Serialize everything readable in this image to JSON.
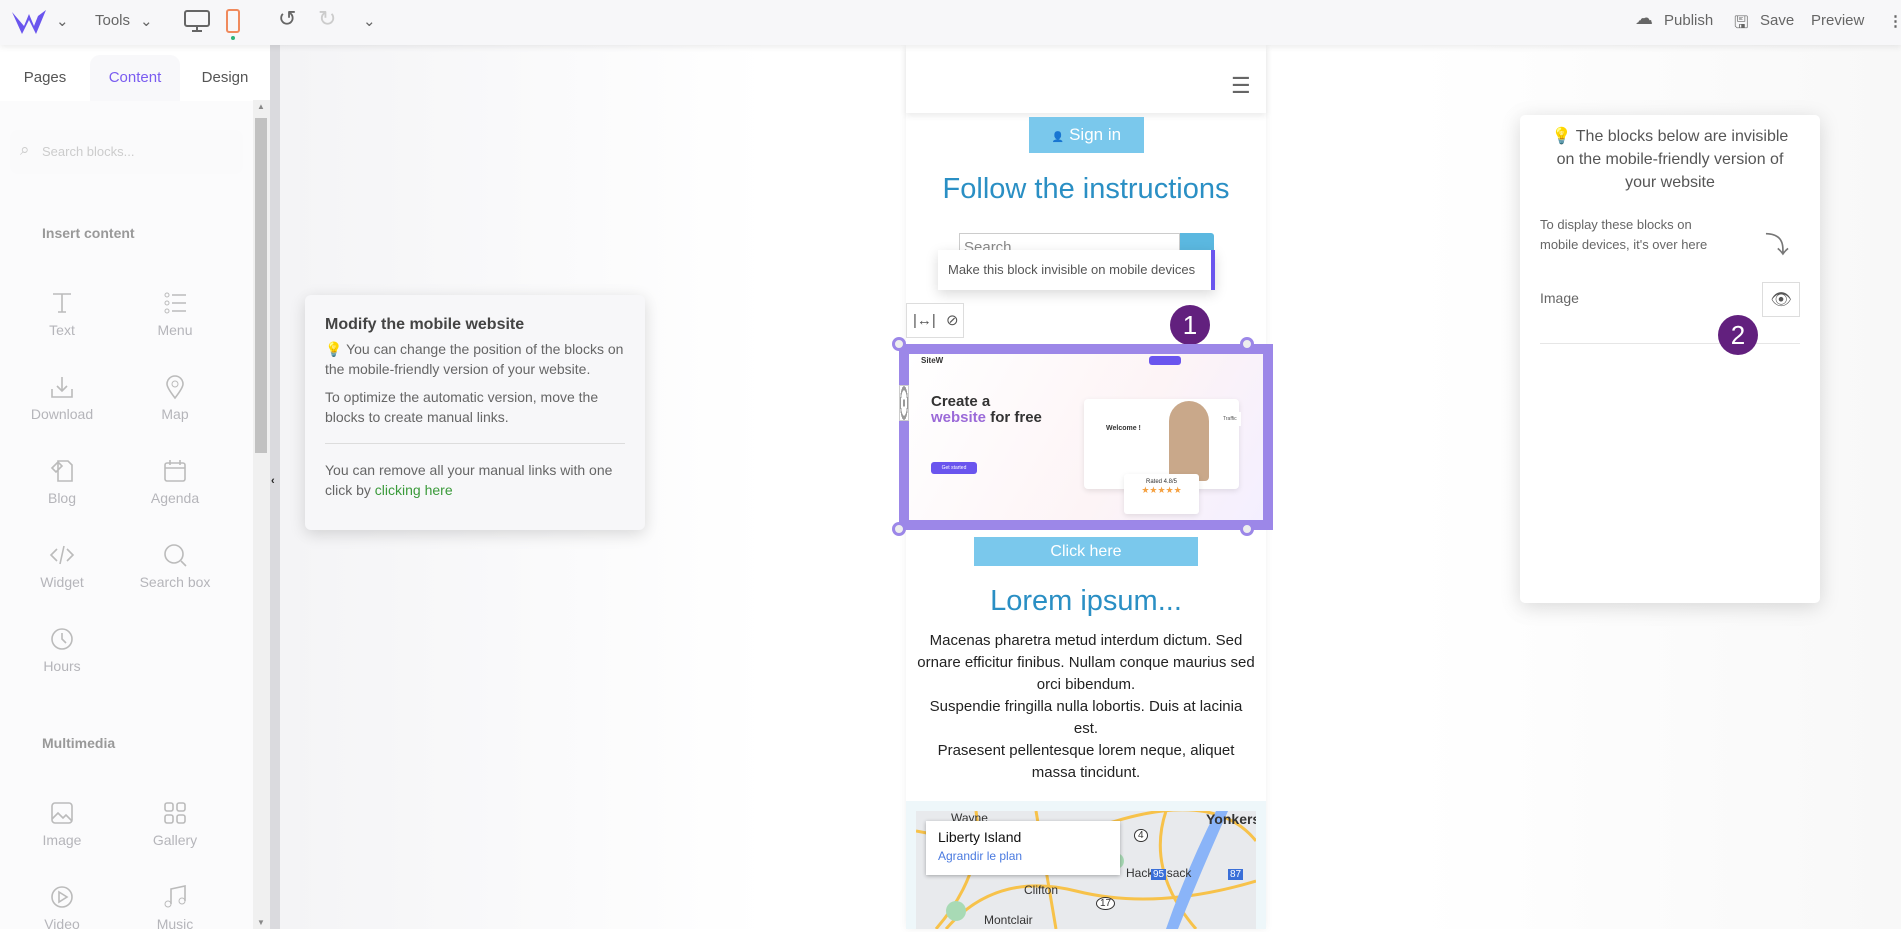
{
  "topbar": {
    "tools": "Tools",
    "publish": "Publish",
    "save": "Save",
    "preview": "Preview"
  },
  "sidebar": {
    "tabs": [
      "Pages",
      "Content",
      "Design"
    ],
    "active_tab": "Content",
    "search_placeholder": "Search blocks...",
    "sections": [
      {
        "title": "Insert content",
        "items": [
          {
            "label": "Text",
            "icon": "text-icon"
          },
          {
            "label": "Menu",
            "icon": "list-icon"
          },
          {
            "label": "Download",
            "icon": "download-icon"
          },
          {
            "label": "Map",
            "icon": "map-pin-icon"
          },
          {
            "label": "Blog",
            "icon": "blog-icon"
          },
          {
            "label": "Agenda",
            "icon": "calendar-icon"
          },
          {
            "label": "Widget",
            "icon": "code-icon"
          },
          {
            "label": "Search box",
            "icon": "search-icon"
          },
          {
            "label": "Hours",
            "icon": "clock-icon"
          }
        ]
      },
      {
        "title": "Multimedia",
        "items": [
          {
            "label": "Image",
            "icon": "image-icon"
          },
          {
            "label": "Gallery",
            "icon": "grid-icon"
          },
          {
            "label": "Video",
            "icon": "play-icon"
          },
          {
            "label": "Music",
            "icon": "music-icon"
          }
        ]
      }
    ]
  },
  "left_card": {
    "title": "Modify the mobile website",
    "p1": "You can change the position of the blocks on the mobile-friendly version of your website.",
    "p2": "To optimize the automatic version, move the blocks to create manual links.",
    "p3": "You can remove all your manual links with one click by ",
    "link": "clicking here"
  },
  "phone": {
    "signin": "Sign in",
    "heading": "Follow the instructions",
    "search_placeholder": "Search",
    "tooltip": "Make this block invisible on mobile devices",
    "badge1": "1",
    "hero": {
      "logo": "SiteW",
      "title1": "Create a",
      "title2a": "website",
      "title2b": " for free",
      "cta": "Get started",
      "welcome": "Welcome !",
      "rated": "Rated 4.8/5",
      "traffic": "Traffic"
    },
    "click_here": "Click here",
    "lorem_title": "Lorem ipsum...",
    "lorem_body": "Macenas pharetra metud interdum dictum. Sed ornare efficitur finibus. Nullam conque maurius sed orci bibendum.\nSuspendie fringilla nulla lobortis. Duis at lacinia est.\nPrasesent pellentesque lorem neque, aliquet massa tincidunt.",
    "map": {
      "place": "Liberty Island",
      "link": "Agrandir le plan",
      "labels": [
        "Wayne",
        "Yonkers",
        "Hackensack",
        "Clifton",
        "Montclair",
        "4",
        "95",
        "87",
        "17"
      ]
    }
  },
  "right_panel": {
    "title": "The blocks below are invisible on the mobile-friendly version of your website",
    "hint": "To display these blocks on mobile devices, it's over here",
    "item": "Image",
    "badge2": "2"
  },
  "colors": {
    "accent": "#7a5cf0",
    "signin": "#7ac8ec",
    "heading": "#2a8fc4",
    "badge": "#62207e",
    "link": "#3a9a3a",
    "mobile": "#f08a5d"
  }
}
